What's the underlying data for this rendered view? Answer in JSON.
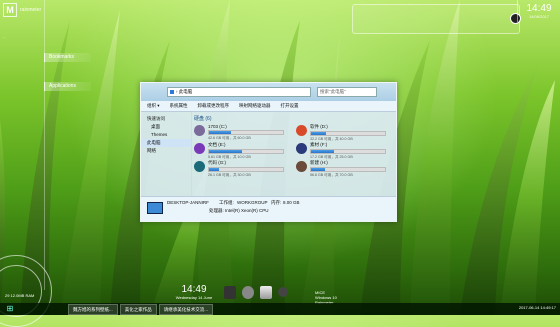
{
  "desktop": {
    "logo_letter": "M",
    "logo_text": "rainmeter",
    "left_text": "...",
    "buttons": [
      "Bookmarks",
      "Applications"
    ],
    "bottom_left": "29  12.0MB  RAM",
    "clock_time": "14:49",
    "clock_date": "14/06/2017"
  },
  "window": {
    "address": "› 此电脑",
    "search_placeholder": "搜索\"此电脑\"",
    "toolbar": [
      "组织 ▾",
      "系统属性",
      "卸载或更改程序",
      "映射网络驱动器",
      "打开设置"
    ],
    "nav": [
      {
        "label": "快速访问"
      },
      {
        "label": "桌面"
      },
      {
        "label": "Themes"
      },
      {
        "label": "此电脑"
      },
      {
        "label": "网络"
      }
    ],
    "section_title": "硬盘 (6)",
    "drives": [
      {
        "name": "1703 (C:)",
        "free": "42.6 GB 可用，共 60.0 GB",
        "used": 0.3,
        "color": "#7a6b9a"
      },
      {
        "name": "软件 (D:)",
        "free": "32.2 GB 可用，共 40.0 GB",
        "used": 0.2,
        "color": "#d84a2a"
      },
      {
        "name": "文档 (E:)",
        "free": "5.61 GB 可用，共 10.0 GB",
        "used": 0.45,
        "color": "#7a3ab8"
      },
      {
        "name": "素材 (F:)",
        "free": "17.2 GB 可用，共 25.0 GB",
        "used": 0.31,
        "color": "#2a3a7a"
      },
      {
        "name": "代码 (G:)",
        "free": "26.1 GB 可用，共 30.0 GB",
        "used": 0.13,
        "color": "#1a6a7a"
      },
      {
        "name": "新建 (H:)",
        "free": "56.6 GB 可用，共 70.0 GB",
        "used": 0.19,
        "color": "#6a4a3a"
      }
    ],
    "details": {
      "computer": "DESKTOP-JANNIRF",
      "workgroup_label": "工作组:",
      "workgroup": "WORKGROUP",
      "memory_label": "内存:",
      "memory": "8.00 GB",
      "cpu_label": "处理器:",
      "cpu": "Intel(R) Xeon(R) CPU"
    }
  },
  "dock": {
    "time": "14:49",
    "date": "Wednesday 14 June",
    "sysinfo": [
      "MICE",
      "Windows 10",
      "Rainmeter"
    ]
  },
  "taskbar": {
    "start_glyph": "⊞",
    "items": [
      "魏方旭的系列壁纸...",
      "美化之家作品",
      "请继承美化技术交流..."
    ],
    "tray": "2017-06-14  14:49:17"
  }
}
